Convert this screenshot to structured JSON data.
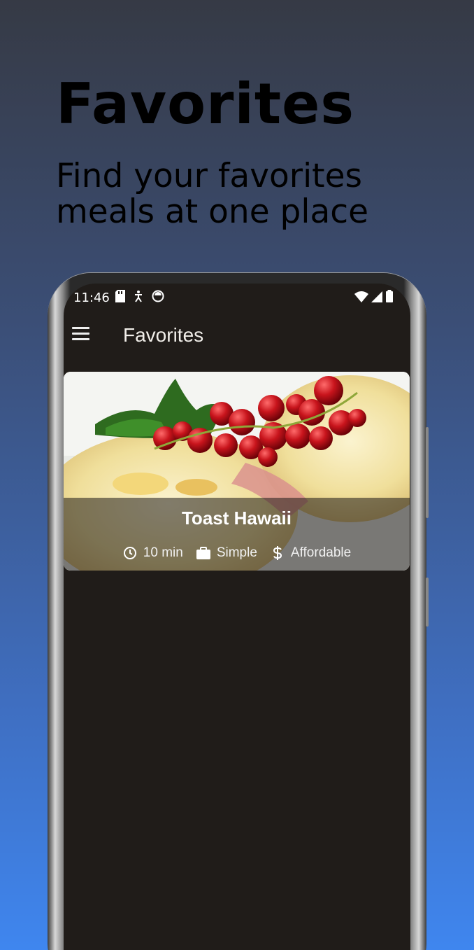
{
  "promo": {
    "title": "Favorites",
    "subtitle": "Find your favorites meals at one place"
  },
  "status_bar": {
    "time": "11:46",
    "left_icons": [
      "sd-card-icon",
      "accessibility-icon",
      "circle-app-icon"
    ],
    "right_icons": [
      "wifi-icon",
      "signal-icon",
      "battery-icon"
    ]
  },
  "app_bar": {
    "menu_icon": "hamburger-menu-icon",
    "title": "Favorites"
  },
  "meals": [
    {
      "title": "Toast Hawaii",
      "duration": "10 min",
      "complexity": "Simple",
      "affordability": "Affordable"
    }
  ],
  "colors": {
    "screen_background": "#201c19",
    "gradient_top": "#363a45",
    "gradient_bottom": "#3f86ef"
  }
}
